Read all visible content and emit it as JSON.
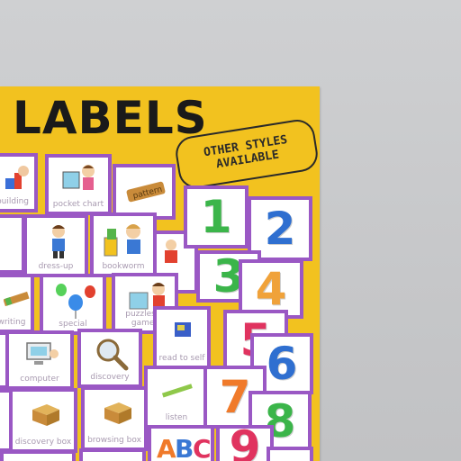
{
  "poster": {
    "title": "LABELS",
    "badge": [
      "OTHER STYLES",
      "AVAILABLE"
    ]
  },
  "picture_cards": [
    {
      "name": "building-card",
      "label": "building"
    },
    {
      "name": "pocket-chart-card",
      "label": "pocket chart"
    },
    {
      "name": "pattern-card",
      "label": ""
    },
    {
      "name": "dress-up-card",
      "label": "dress-up"
    },
    {
      "name": "bookworm-card",
      "label": "bookworm"
    },
    {
      "name": "math-card",
      "label": ""
    },
    {
      "name": "writing-card",
      "label": "writing"
    },
    {
      "name": "special-card",
      "label": "special"
    },
    {
      "name": "puzzles-games-card",
      "label": "puzzles & games"
    },
    {
      "name": "read-to-self-card",
      "label": "read to self"
    },
    {
      "name": "computer-card",
      "label": "computer"
    },
    {
      "name": "discovery-card",
      "label": "discovery"
    },
    {
      "name": "listen-card",
      "label": "listen"
    },
    {
      "name": "discovery-box-card",
      "label": "discovery box"
    },
    {
      "name": "browsing-box-card",
      "label": "browsing box"
    },
    {
      "name": "abc-card",
      "label": ""
    }
  ],
  "number_cards": [
    {
      "value": "1",
      "color": "#3bb54a"
    },
    {
      "value": "2",
      "color": "#2f6fd0"
    },
    {
      "value": "3",
      "color": "#3bb54a"
    },
    {
      "value": "4",
      "color": "#f0a23a"
    },
    {
      "value": "5",
      "color": "#e0335f"
    },
    {
      "value": "6",
      "color": "#2f6fd0"
    },
    {
      "value": "7",
      "color": "#f07a2a"
    },
    {
      "value": "8",
      "color": "#3bb54a"
    },
    {
      "value": "9",
      "color": "#e0335f"
    }
  ],
  "colors": {
    "background": "#c6c7c9",
    "poster": "#f2c21f",
    "card_border": "#9a58c4"
  }
}
